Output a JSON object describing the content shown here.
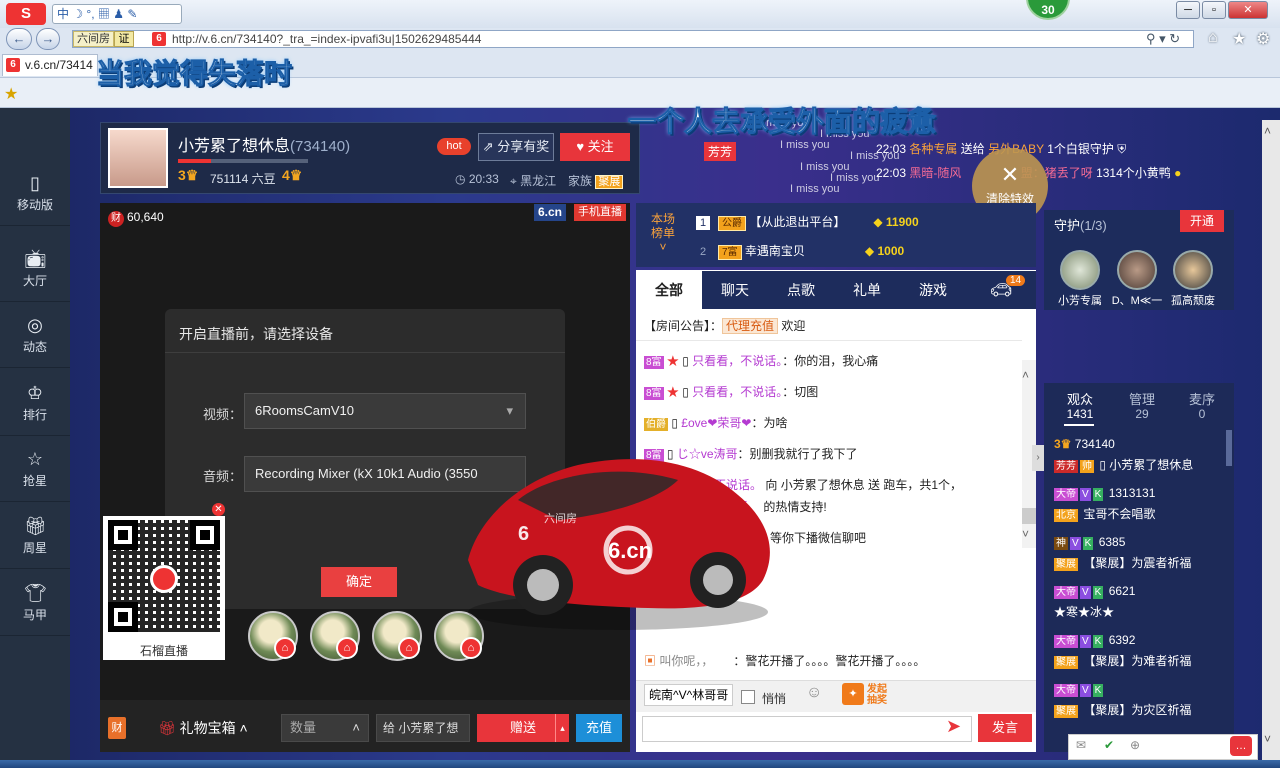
{
  "browser": {
    "ime": {
      "label": "中 ☽ °, ▦ ♟ ✎"
    },
    "badge_count": "30",
    "addr": {
      "site_tag": "六间房",
      "cert_tag": "证",
      "url": "http://v.6.cn/734140?_tra_=index-ipvafi3u|1502629485444"
    },
    "tab": {
      "title": "v.6.cn/73414"
    }
  },
  "lyrics": {
    "line1": "当我觉得失落时",
    "line2": "一个人去承受外面的疲惫"
  },
  "sidebar": {
    "items": [
      {
        "icon": "mobile-icon",
        "label": "移动版"
      },
      {
        "icon": "tv-icon",
        "label": "大厅"
      },
      {
        "icon": "compass-icon",
        "label": "动态"
      },
      {
        "icon": "crown-icon",
        "label": "排行"
      },
      {
        "icon": "star-icon",
        "label": "抢星"
      },
      {
        "icon": "gift-icon",
        "label": "周星"
      },
      {
        "icon": "shirt-icon",
        "label": "马甲"
      }
    ]
  },
  "anchor": {
    "name": "小芳累了想休息",
    "room_id": "(734140)",
    "level_left": "3",
    "coins": "751114 六豆",
    "level_right": "4",
    "progress": 0.25,
    "hot": "hot",
    "share": "分享有奖",
    "follow": "关注",
    "time": "20:33",
    "location": "黑龙江",
    "family_label": "家族",
    "family_badge": "聚展"
  },
  "video": {
    "wealth": "60,640",
    "brand": "6.cn",
    "mobile_live": "手机直播",
    "dialog": {
      "title": "开启直播前，请选择设备",
      "video_label": "视频：",
      "video_value": "6RoomsCamV10",
      "audio_label": "音频：",
      "audio_value": "Recording Mixer (kX 10k1 Audio (3550",
      "ok": "确定"
    },
    "qr_caption": "石榴直播"
  },
  "giftbar": {
    "cai": "财",
    "gift_box": "礼物宝箱",
    "qty_placeholder": "数量",
    "give_to": "给  小芳累了想",
    "send": "赠送",
    "recharge": "充值"
  },
  "notice": {
    "host_tag": "芳芳",
    "line1_time": "22:03",
    "line1_a": "各种专属",
    "line1_b": "送给",
    "line1_c": "另外BABY",
    "line1_d": "1个白银守护",
    "line2_time": "22:03",
    "line2_a": "黑暗-随风",
    "line2_b": "盟：猪丢了呀",
    "line2_c": "1314个小黄鸭",
    "clear_fx": "清除特效",
    "miss_you": "I miss you"
  },
  "rank": {
    "label_1": "本场",
    "label_2": "榜单",
    "rows": [
      {
        "no": "1",
        "badge": "公爵",
        "name": "【从此退出平台】",
        "score": "11900"
      },
      {
        "no": "2",
        "badge": "7富",
        "name": "幸遇南宝贝",
        "score": "1000"
      }
    ]
  },
  "chat": {
    "tabs": [
      "全部",
      "聊天",
      "点歌",
      "礼单",
      "游戏"
    ],
    "car_count": "14",
    "announce_label": "【房间公告】：",
    "announce_tag": "代理充值",
    "announce_text": "欢迎",
    "messages": [
      {
        "lvl": "8富",
        "name": "只看看，不说话。",
        "text": "：你的泪，我心痛"
      },
      {
        "lvl": "8富",
        "name": "只看看，不说话。",
        "text": "：切图"
      },
      {
        "lvl": "伯爵",
        "name": "£ove❤荣哥❤",
        "text": "：为啥"
      },
      {
        "lvl": "8富",
        "name": "じ☆ve涛哥",
        "text": "：别删我就行了我下了"
      },
      {
        "lvl": "",
        "name": "看，不说话。",
        "text": "向 小芳累了想休息 送 跑车，共1个，"
      },
      {
        "lvl": "",
        "name": "说话。",
        "text": "的热情支持!"
      },
      {
        "lvl": "",
        "name": "",
        "text": "等你下播微信聊吧"
      }
    ],
    "bottom_msg_a": "叫你呢，，",
    "bottom_msg_b": "：警花开播了。。。。警花开播了。。。。",
    "input_target": "皖南^V^林哥哥",
    "quiet_label": "悄悄",
    "lottery_1": "发起",
    "lottery_2": "抽奖",
    "send": "发言"
  },
  "guard": {
    "title": "守护",
    "count": "(1/3)",
    "open": "开通",
    "members": [
      "小芳专属",
      "D、M≪一",
      "孤高颓废"
    ]
  },
  "audience": {
    "tabs": [
      {
        "label": "观众",
        "count": "1431"
      },
      {
        "label": "管理",
        "count": "29"
      },
      {
        "label": "麦序",
        "count": "0"
      }
    ],
    "rows": [
      {
        "l1": "734140",
        "tag": "芳芳",
        "l2": "小芳累了想休息"
      },
      {
        "l1": "1313131",
        "tag": "北京",
        "l2": "宝哥不会唱歌"
      },
      {
        "l1": "6385",
        "tag": "聚展",
        "l2": "【聚展】为震者祈福"
      },
      {
        "l1": "6621",
        "tag": "",
        "l2": "★寒★冰★"
      },
      {
        "l1": "6392",
        "tag": "聚展",
        "l2": "【聚展】为难者祈福"
      },
      {
        "l1": "",
        "tag": "聚展",
        "l2": "【聚展】为灾区祈福"
      }
    ]
  },
  "car": {
    "brand": "6.cn",
    "tagline": "六间房"
  },
  "colors": {
    "accent_red": "#e8353b",
    "gold": "#f3a21c",
    "bg_blue": "#1d2c5c"
  }
}
